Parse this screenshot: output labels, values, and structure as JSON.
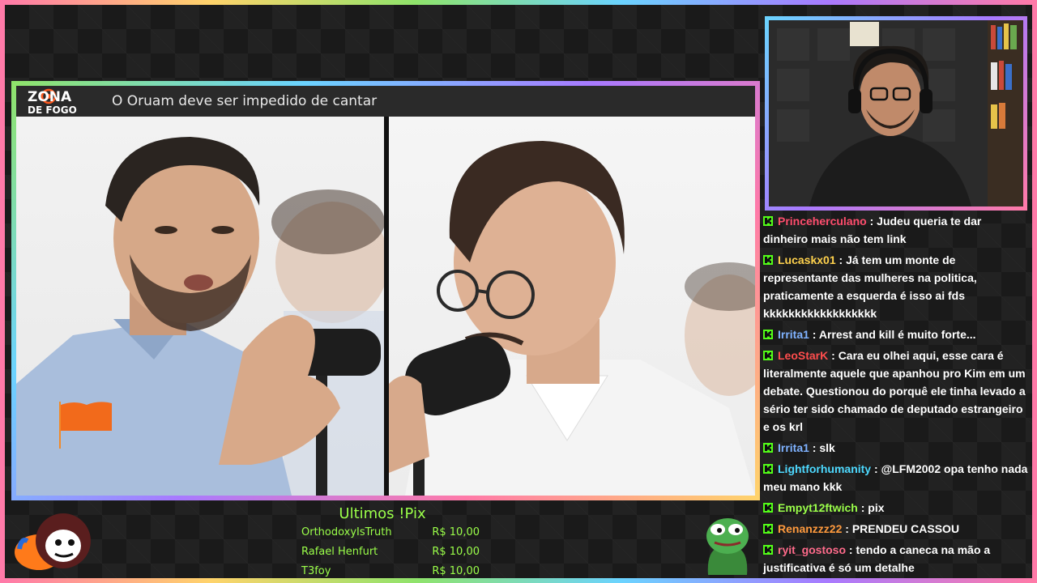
{
  "stream": {
    "video_title": "O Oruam deve ser impedido de cantar",
    "logo": {
      "line1": "ZONA",
      "line2": "DE FOGO"
    }
  },
  "chat": {
    "messages": [
      {
        "user": "Princeherculano",
        "color": "#ff4d6d",
        "text": "Judeu queria te dar dinheiro mais não tem link"
      },
      {
        "user": "Lucaskx01",
        "color": "#ffd24d",
        "text": "Já tem um monte de representante das mulheres na politica, praticamente a esquerda é isso ai fds kkkkkkkkkkkkkkkkkk"
      },
      {
        "user": "Irrita1",
        "color": "#7fb2ff",
        "text": "Arrest and kill é muito forte..."
      },
      {
        "user": "LeoStarK",
        "color": "#ff4d4d",
        "text": "Cara eu olhei aqui, esse cara é literalmente aquele que apanhou pro Kim em um debate. Questionou do porquê ele tinha levado a sério ter sido chamado de deputado estrangeiro e os krl"
      },
      {
        "user": "Irrita1",
        "color": "#7fb2ff",
        "text": "slk"
      },
      {
        "user": "Lightforhumanity",
        "color": "#4dd9ff",
        "text": "@LFM2002 opa tenho nada meu mano kkk"
      },
      {
        "user": "Empyt12ftwich",
        "color": "#9bff4a",
        "text": "pix"
      },
      {
        "user": "Renanzzz22",
        "color": "#ff9a3d",
        "text": "PRENDEU CASSOU"
      },
      {
        "user": "ryit_gostoso",
        "color": "#ff6b8b",
        "text": "tendo a caneca na mão a justificativa é só um detalhe"
      }
    ]
  },
  "pix": {
    "title": "Ultimos !Pix",
    "entries": [
      {
        "name": "OrthodoxyIsTruth",
        "amount": "R$ 10,00"
      },
      {
        "name": "Rafael Henfurt",
        "amount": "R$ 10,00"
      },
      {
        "name": "T3foy",
        "amount": "R$ 10,00"
      }
    ]
  },
  "colors": {
    "accent_green": "#9bff4a",
    "frame_gradient": [
      "#8fe36b",
      "#6bd3ff",
      "#a87aff",
      "#ff7aa8",
      "#ffd36b"
    ]
  },
  "icons": {
    "chat_badge": "kick-badge-icon",
    "bottom_left": "cartoon-avatar-icon",
    "bottom_right": "pepe-frog-icon"
  }
}
